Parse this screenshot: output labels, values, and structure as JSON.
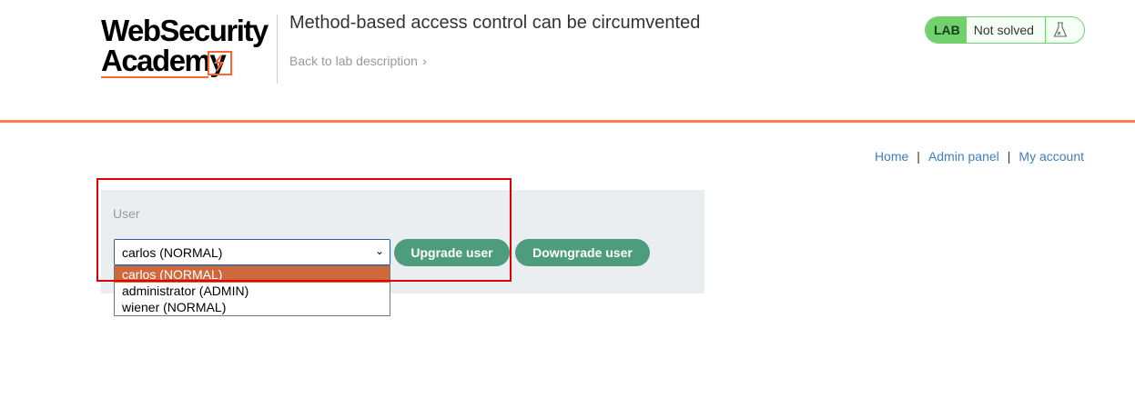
{
  "header": {
    "logo_line1": "WebSecurity",
    "logo_line2": "Academy",
    "lab_title": "Method-based access control can be circumvented",
    "back_link": "Back to lab description",
    "lab_badge": "LAB",
    "lab_status": "Not solved"
  },
  "nav": {
    "home": "Home",
    "admin_panel": "Admin panel",
    "my_account": "My account",
    "separator": "|"
  },
  "form": {
    "label": "User",
    "selected_value": "carlos (NORMAL)",
    "options": [
      "carlos (NORMAL)",
      "administrator (ADMIN)",
      "wiener (NORMAL)"
    ],
    "upgrade_button": "Upgrade user",
    "downgrade_button": "Downgrade user"
  },
  "colors": {
    "accent_orange": "#ff6633",
    "lab_green": "#70d16d",
    "button_green": "#4d9c7d",
    "link_blue": "#3d7fbf",
    "highlight_red": "#e00000"
  },
  "icons": {
    "back_chevron": "double-chevron-right-icon",
    "lab_flask": "flask-icon",
    "select_caret": "chevron-down-icon"
  }
}
